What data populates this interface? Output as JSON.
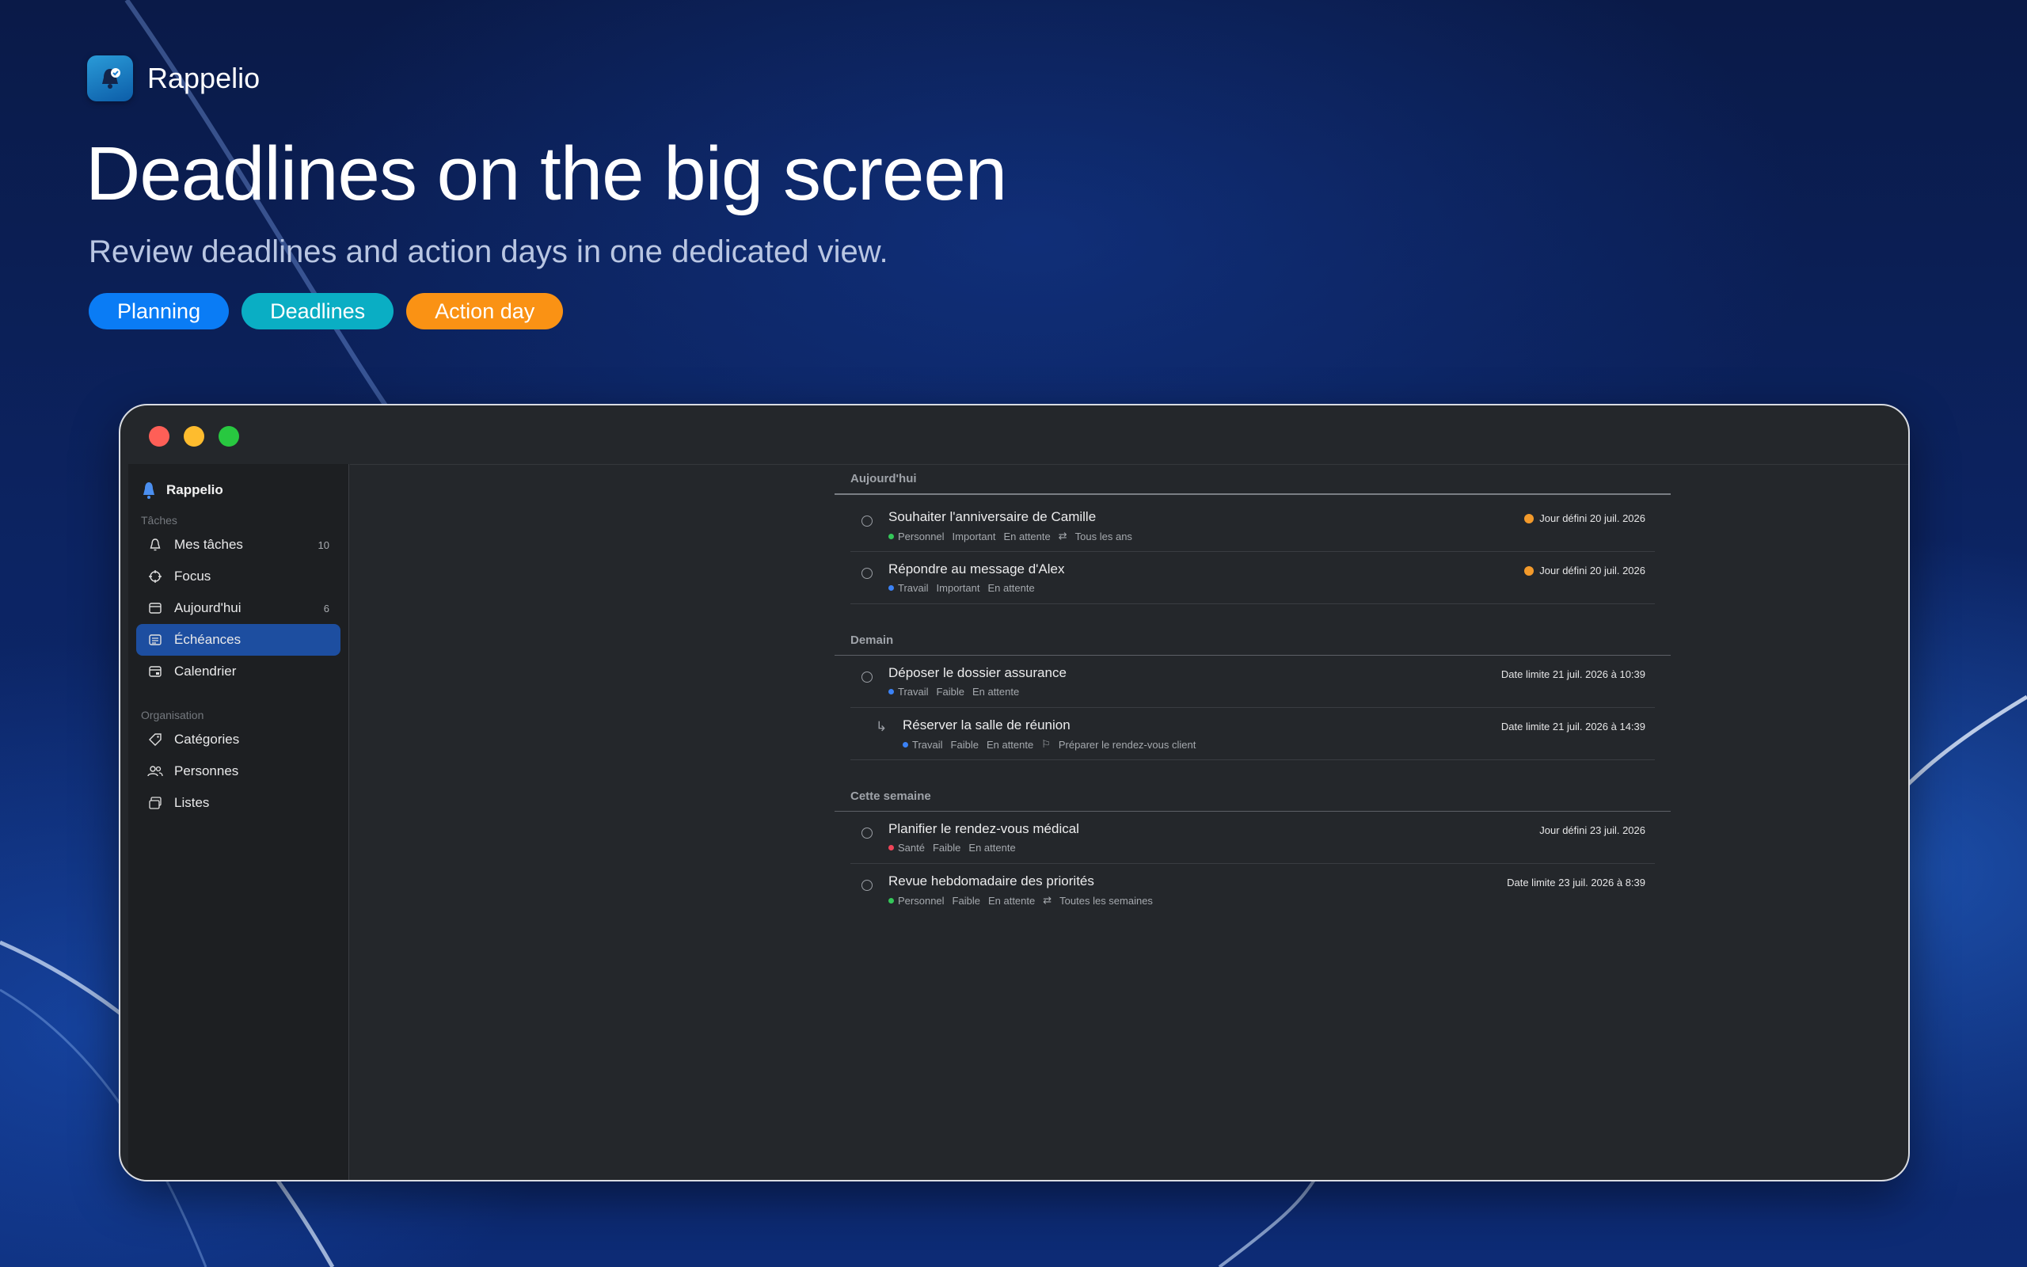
{
  "brand": {
    "name": "Rappelio"
  },
  "hero": {
    "headline": "Deadlines on the big screen",
    "subline": "Review deadlines and action days in one dedicated view.",
    "pills": [
      {
        "label": "Planning",
        "color": "#0a7cf5"
      },
      {
        "label": "Deadlines",
        "color": "#0aaec4"
      },
      {
        "label": "Action day",
        "color": "#fa9214"
      }
    ]
  },
  "window": {
    "traffic_lights": {
      "close": "#fe5f57",
      "minimize": "#febc2e",
      "zoom": "#28c840"
    },
    "sidebar": {
      "app_name": "Rappelio",
      "section_tasks": "Tâches",
      "items": [
        {
          "label": "Mes tâches",
          "count": "10",
          "icon": "bell-icon"
        },
        {
          "label": "Focus",
          "count": "",
          "icon": "crosshair-icon"
        },
        {
          "label": "Aujourd'hui",
          "count": "6",
          "icon": "calendar-day-icon"
        },
        {
          "label": "Échéances",
          "count": "",
          "icon": "list-icon",
          "active": true
        },
        {
          "label": "Calendrier",
          "count": "",
          "icon": "calendar-icon"
        }
      ],
      "section_org": "Organisation",
      "org_items": [
        {
          "label": "Catégories",
          "icon": "tag-icon"
        },
        {
          "label": "Personnes",
          "icon": "people-icon"
        },
        {
          "label": "Listes",
          "icon": "lists-icon"
        }
      ]
    },
    "groups": [
      {
        "title": "Aujourd'hui",
        "tasks": [
          {
            "title": "Souhaiter l'anniversaire de Camille",
            "category": "Personnel",
            "category_color": "#34c759",
            "priority": "Important",
            "status": "En attente",
            "repeat": "Tous les ans",
            "due": "Jour défini 20 juil. 2026",
            "due_badge": true
          },
          {
            "title": "Répondre au message d'Alex",
            "category": "Travail",
            "category_color": "#3b82f6",
            "priority": "Important",
            "status": "En attente",
            "due": "Jour défini 20 juil. 2026",
            "due_badge": true
          }
        ]
      },
      {
        "title": "Demain",
        "tasks": [
          {
            "title": "Déposer le dossier assurance",
            "category": "Travail",
            "category_color": "#3b82f6",
            "priority": "Faible",
            "status": "En attente",
            "due": "Date limite 21 juil. 2026 à 10:39"
          },
          {
            "title": "Réserver la salle de réunion",
            "category": "Travail",
            "category_color": "#3b82f6",
            "priority": "Faible",
            "status": "En attente",
            "parent": "Préparer le rendez-vous client",
            "due": "Date limite 21 juil. 2026 à 14:39",
            "subtask": true
          }
        ]
      },
      {
        "title": "Cette semaine",
        "tasks": [
          {
            "title": "Planifier le rendez-vous médical",
            "category": "Santé",
            "category_color": "#ef4458",
            "priority": "Faible",
            "status": "En attente",
            "due": "Jour défini 23 juil. 2026"
          },
          {
            "title": "Revue hebdomadaire des priorités",
            "category": "Personnel",
            "category_color": "#34c759",
            "priority": "Faible",
            "status": "En attente",
            "repeat": "Toutes les semaines",
            "due": "Date limite 23 juil. 2026 à 8:39"
          }
        ]
      }
    ]
  }
}
